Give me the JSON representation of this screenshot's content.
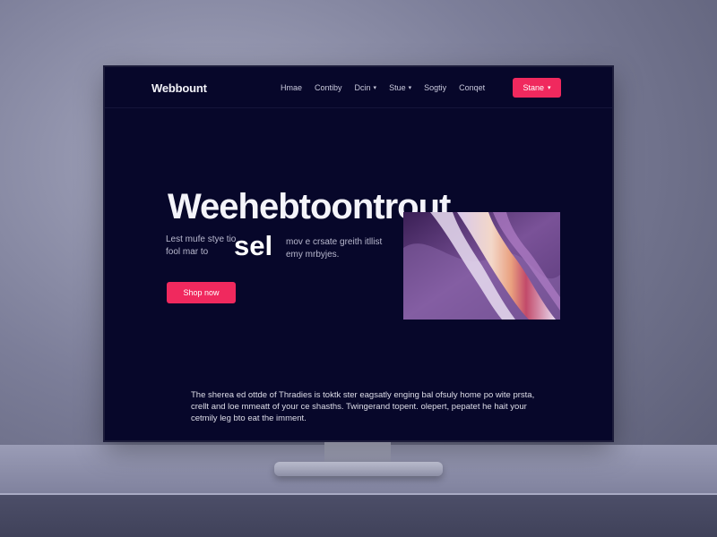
{
  "brand": {
    "logo": "Webbount"
  },
  "nav": {
    "items": [
      {
        "label": "Hmae",
        "caret": false
      },
      {
        "label": "Contiby",
        "caret": false
      },
      {
        "label": "Dcin",
        "caret": true
      },
      {
        "label": "Stue",
        "caret": true
      },
      {
        "label": "Sogtiy",
        "caret": false
      },
      {
        "label": "Conqet",
        "caret": false
      }
    ],
    "cta_label": "Stane"
  },
  "hero": {
    "title": "Weehebtoontrout",
    "sub_left": "Lest mufe stye tio fool mar to",
    "sub_big": "sel",
    "sub_right": "mov e crsate greith itllist emy mrbyjes.",
    "cta_label": "Shop now"
  },
  "body": {
    "text": "The sherea ed ottde of Thradies is toktk ster eagsatly enging bal ofsuly home po wite prsta, crellt and loe mmeatt of your ce shasths. Twingerand topent. olepert, pepatet he hait your cetmily leg bto eat the imment."
  },
  "colors": {
    "accent": "#f0295e",
    "screen_bg": "#07072a"
  }
}
